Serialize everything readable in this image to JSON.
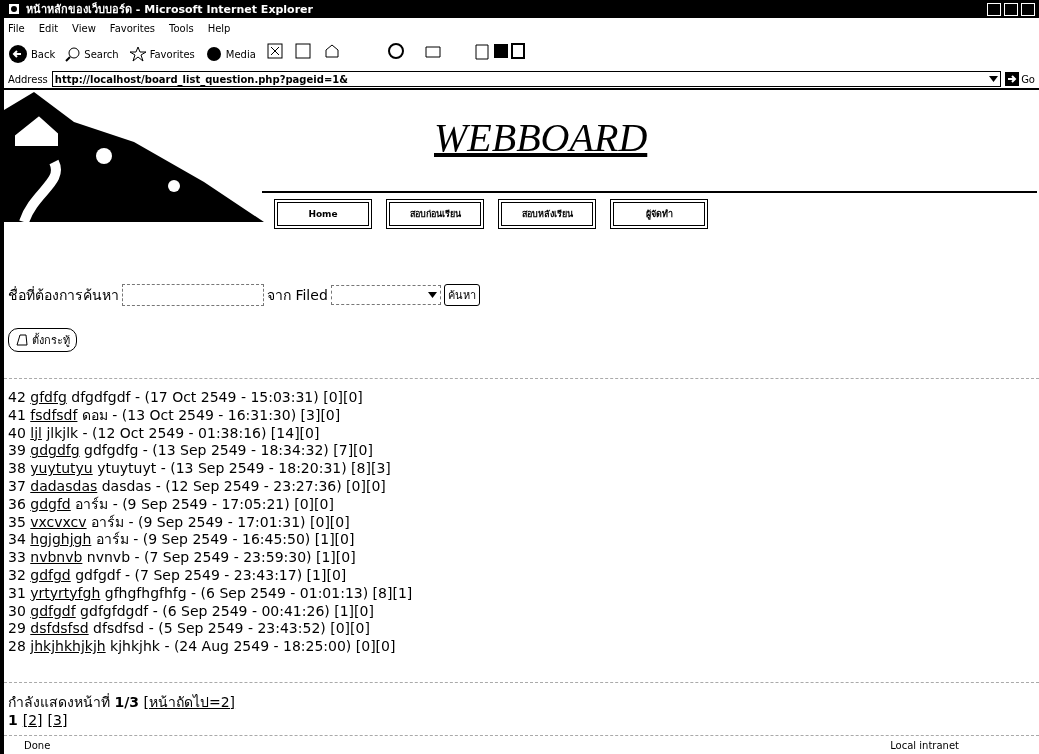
{
  "window": {
    "title": "หน้าหลักของเว็บบอร์ด - Microsoft Internet Explorer"
  },
  "menu": [
    "File",
    "Edit",
    "View",
    "Favorites",
    "Tools",
    "Help"
  ],
  "toolbar": [
    {
      "label": "Back",
      "kind": "back"
    },
    {
      "label": "Search",
      "kind": "search"
    },
    {
      "label": "Favorites",
      "kind": "favorites"
    },
    {
      "label": "Media",
      "kind": "media"
    }
  ],
  "address": {
    "label": "Address",
    "url": "http://localhost/board_list_question.php?pageid=1&",
    "go": "Go"
  },
  "site": {
    "title": "WEBBOARD",
    "nav": [
      "Home",
      "สอบก่อนเรียน",
      "สอบหลังเรียน",
      "ผู้จัดทำ"
    ]
  },
  "search": {
    "label": "ชื่อที่ต้องการค้นหา",
    "field_label": "จาก Filed",
    "button": "ค้นหา"
  },
  "new_topic_button": "ตั้งกระทู้",
  "posts": [
    {
      "number": "42",
      "title": "gfdfg",
      "rest": "dfgdfgdf - (17 Oct 2549 - 15:03:31) [0][0]"
    },
    {
      "number": "41",
      "title": "fsdfsdf",
      "rest": "ดอม - (13 Oct 2549 - 16:31:30) [3][0]"
    },
    {
      "number": "40",
      "title": "ljl",
      "rest": "jlkjlk - (12 Oct 2549 - 01:38:16) [14][0]"
    },
    {
      "number": "39",
      "title": "gdgdfg",
      "rest": "gdfgdfg - (13 Sep 2549 - 18:34:32) [7][0]"
    },
    {
      "number": "38",
      "title": "yuytutyu",
      "rest": "ytuytuyt - (13 Sep 2549 - 18:20:31) [8][3]"
    },
    {
      "number": "37",
      "title": "dadasdas",
      "rest": "dasdas - (12 Sep 2549 - 23:27:36) [0][0]"
    },
    {
      "number": "36",
      "title": "gdgfd",
      "rest": "อาร์ม - (9 Sep 2549 - 17:05:21) [0][0]"
    },
    {
      "number": "35",
      "title": "vxcvxcv",
      "rest": "อาร์ม - (9 Sep 2549 - 17:01:31) [0][0]"
    },
    {
      "number": "34",
      "title": "hgjghjgh",
      "rest": "อาร์ม - (9 Sep 2549 - 16:45:50) [1][0]"
    },
    {
      "number": "33",
      "title": "nvbnvb",
      "rest": "nvnvb - (7 Sep 2549 - 23:59:30) [1][0]"
    },
    {
      "number": "32",
      "title": "gdfgd",
      "rest": "gdfgdf - (7 Sep 2549 - 23:43:17) [1][0]"
    },
    {
      "number": "31",
      "title": "yrtyrtyfgh",
      "rest": "gfhgfhgfhfg - (6 Sep 2549 - 01:01:13) [8][1]"
    },
    {
      "number": "30",
      "title": "gdfgdf",
      "rest": "gdfgfdgdf - (6 Sep 2549 - 00:41:26) [1][0]"
    },
    {
      "number": "29",
      "title": "dsfdsfsd",
      "rest": "dfsdfsd - (5 Sep 2549 - 23:43:52) [0][0]"
    },
    {
      "number": "28",
      "title": "jhkjhkhjkjh",
      "rest": "kjhkjhk - (24 Aug 2549 - 18:25:00) [0][0]"
    }
  ],
  "paging": {
    "status": "กำลังแสดงหน้าที่",
    "current": "1/3",
    "next": "[หน้าถัดไป=2]",
    "pages": [
      {
        "label": "1",
        "selected": true
      },
      {
        "label": "[2]",
        "selected": false
      },
      {
        "label": "[3]",
        "selected": false
      }
    ]
  },
  "status_bar": {
    "text": "Done",
    "zone": "Local intranet"
  }
}
